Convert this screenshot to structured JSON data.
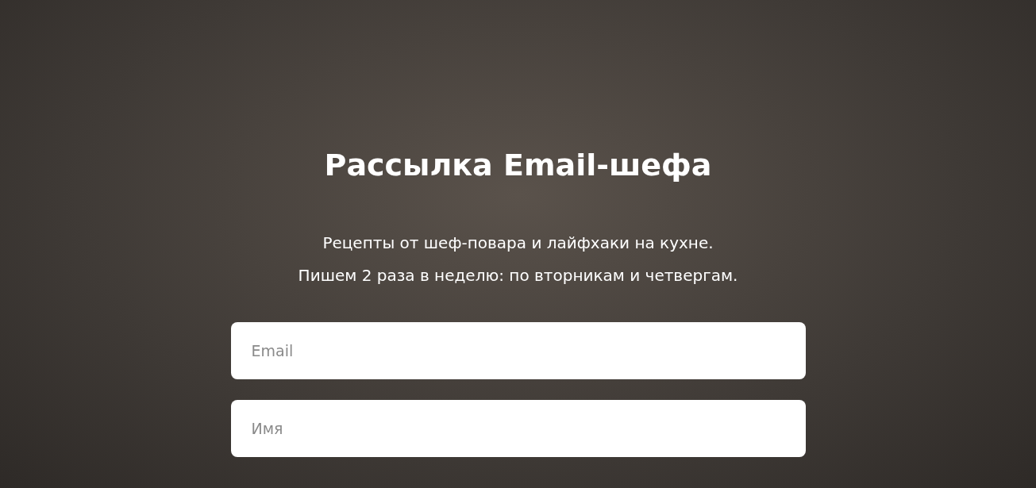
{
  "title": "Рассылка Email-шефа",
  "subtitle_lines": [
    "Рецепты от шеф-повара и лайфхаки на кухне.",
    "Пишем 2 раза в неделю: по вторникам и четвергам."
  ],
  "fields": [
    {
      "placeholder": "Email"
    },
    {
      "placeholder": "Имя"
    }
  ]
}
